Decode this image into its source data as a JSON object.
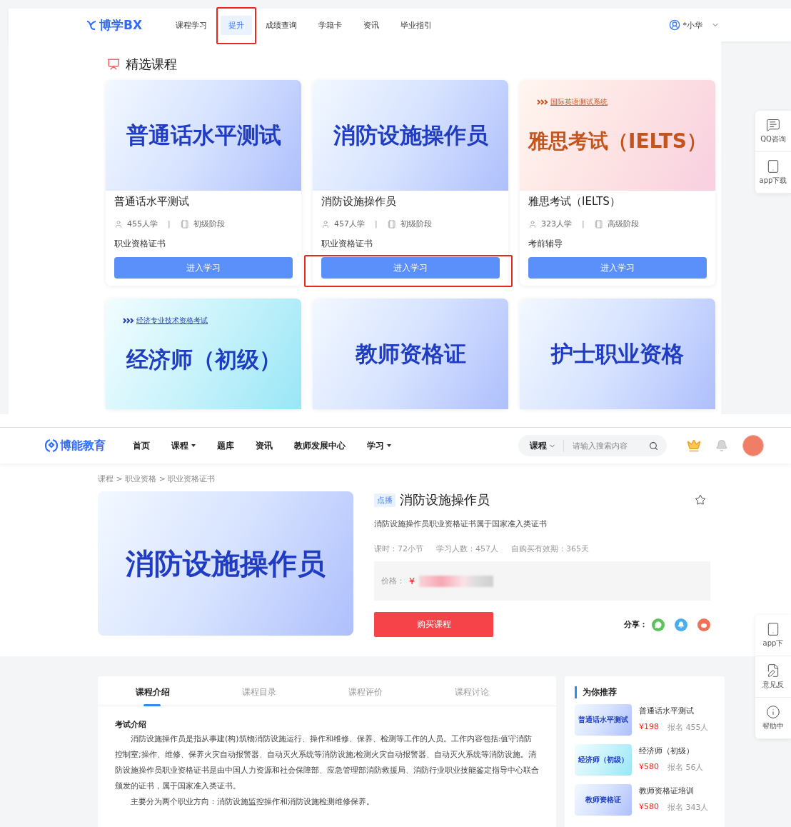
{
  "top": {
    "header": {
      "logo": "博学BX",
      "nav": [
        {
          "label": "课程学习",
          "selected": false,
          "highlighted": false
        },
        {
          "label": "提升",
          "selected": true,
          "highlighted": true
        },
        {
          "label": "成绩查询",
          "selected": false,
          "highlighted": false
        },
        {
          "label": "学籍卡",
          "selected": false,
          "highlighted": false
        },
        {
          "label": "资讯",
          "selected": false,
          "highlighted": false
        },
        {
          "label": "毕业指引",
          "selected": false,
          "highlighted": false
        }
      ],
      "user": "*小华"
    },
    "section_title": "精选课程",
    "courses": [
      {
        "kind": "blue",
        "banner_title": "普通话水平测试",
        "title": "普通话水平测试",
        "learners": "455人学",
        "separator": "|",
        "level": "初级阶段",
        "category": "职业资格证书",
        "button": "进入学习",
        "highlighted": false
      },
      {
        "kind": "blue",
        "banner_title": "消防设施操作员",
        "title": "消防设施操作员",
        "learners": "457人学",
        "separator": "|",
        "level": "初级阶段",
        "category": "职业资格证书",
        "button": "进入学习",
        "highlighted": true
      },
      {
        "kind": "peach",
        "banner_tag": "国际英语测试系统",
        "banner_title": "雅思考试（IELTS）",
        "title": "雅思考试（IELTS）",
        "learners": "323人学",
        "separator": "|",
        "level": "高级阶段",
        "category": "考前辅导",
        "button": "进入学习",
        "highlighted": false
      },
      {
        "kind": "cyan",
        "banner_tag": "经济专业技术资格考试",
        "banner_title": "经济师（初级）"
      },
      {
        "kind": "blue",
        "banner_title": "教师资格证"
      },
      {
        "kind": "blue",
        "banner_title": "护士职业资格"
      }
    ],
    "side_tools": [
      {
        "kind": "chat",
        "label": "QQ咨询"
      },
      {
        "kind": "tablet",
        "label": "app下载"
      }
    ]
  },
  "bottom": {
    "header": {
      "logo": "博能教育",
      "nav": [
        {
          "label": "首页",
          "dropdown": false
        },
        {
          "label": "课程",
          "dropdown": true
        },
        {
          "label": "题库",
          "dropdown": false
        },
        {
          "label": "资讯",
          "dropdown": false
        },
        {
          "label": "教师发展中心",
          "dropdown": false
        },
        {
          "label": "学习",
          "dropdown": true
        }
      ],
      "search_scope": "课程",
      "search_placeholder": "请输入搜索内容"
    },
    "breadcrumb": "课程 > 职业资格 > 职业资格证书",
    "course": {
      "banner_title": "消防设施操作员",
      "badge": "点播",
      "title": "消防设施操作员",
      "description": "消防设施操作员职业资格证书属于国家准入类证书",
      "stats": [
        "课时：72小节",
        "学习人数：457人",
        "自购买有效期：365天"
      ],
      "price_label": "价格：",
      "currency": "¥",
      "buy_button": "购买课程",
      "share_label": "分享："
    },
    "tabs": [
      {
        "label": "课程介绍",
        "selected": true
      },
      {
        "label": "课程目录",
        "selected": false
      },
      {
        "label": "课程评价",
        "selected": false
      },
      {
        "label": "课程讨论",
        "selected": false
      }
    ],
    "intro": {
      "heading": "考试介绍",
      "paragraphs": [
        "消防设施操作员是指从事建(构)筑物消防设施运行、操作和维修、保养、检测等工作的人员。工作内容包括:值守消防控制室;操作、维修、保养火灾自动报警器、自动灭火系统等消防设施;检测火灾自动报警器、自动灭火系统等消防设施。消防设施操作员职业资格证书是由中国人力资源和社会保障部、应急管理部消防救援局、消防行业职业技能鉴定指导中心联合颁发的证书，属于国家准入类证书。",
        "主要分为两个职业方向：消防设施监控操作和消防设施检测维修保养。"
      ]
    },
    "recommend": {
      "title": "为你推荐",
      "items": [
        {
          "kind": "blue",
          "thumb_title": "普通话水平测试",
          "title": "普通话水平测试",
          "price": "¥198",
          "enrolled": "报名 455人"
        },
        {
          "kind": "cyan",
          "thumb_title": "经济师（初级）",
          "title": "经济师（初级）",
          "price": "¥580",
          "enrolled": "报名 56人"
        },
        {
          "kind": "blue",
          "thumb_title": "教师资格证",
          "title": "教师资格证培训",
          "price": "¥580",
          "enrolled": "报名 343人"
        }
      ]
    },
    "side_tools": [
      {
        "kind": "tablet",
        "label": "app下"
      },
      {
        "kind": "feedback",
        "label": "意见反"
      },
      {
        "kind": "info",
        "label": "帮助中"
      }
    ]
  }
}
